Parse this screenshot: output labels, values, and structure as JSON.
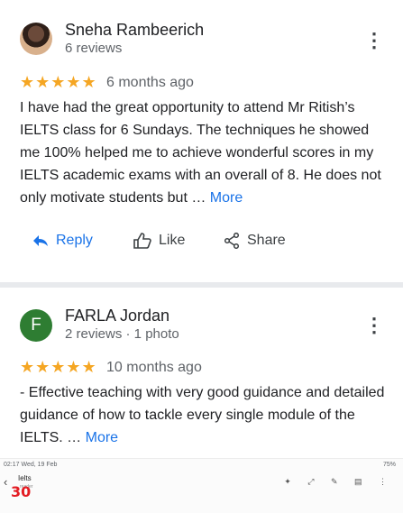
{
  "reviews": [
    {
      "name": "Sneha Rambeerich",
      "meta": "6 reviews",
      "stars": "★★★★★",
      "age": "6 months ago",
      "text": "I have had the great opportunity to attend Mr Ritish’s IELTS class for 6 Sundays. The techniques he showed me 100% helped me to achieve wonderful scores in my IELTS academic exams with an overall of 8. He does not only motivate students but …",
      "more": "More",
      "rating": 5
    },
    {
      "name": "FARLA Jordan",
      "initial": "F",
      "meta": "2 reviews · 1 photo",
      "stars": "★★★★★",
      "age": "10 months ago",
      "text": "- Effective teaching with very good guidance and detailed guidance of how to tackle every single module of the IELTS. …",
      "more": "More",
      "rating": 5
    }
  ],
  "actions": {
    "reply": "Reply",
    "like": "Like",
    "share": "Share"
  },
  "status": {
    "time": "02:17  Wed, 19 Feb",
    "right": "75%",
    "app_title": "Ielts",
    "app_sub": "reader",
    "logo": "30"
  },
  "colors": {
    "star": "#f5a623",
    "link": "#1a73e8",
    "avatar_f": "#2e7d32"
  }
}
